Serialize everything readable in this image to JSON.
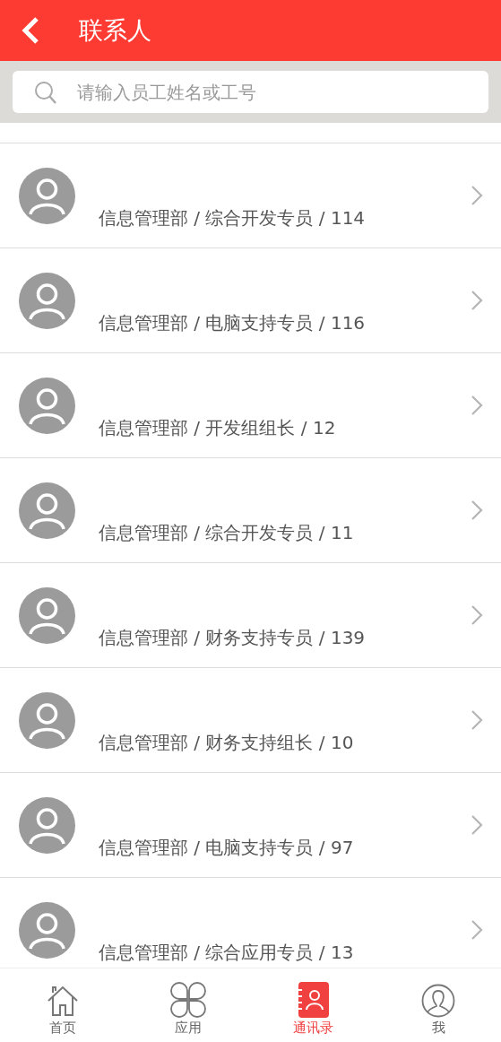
{
  "header": {
    "title": "联系人"
  },
  "search": {
    "placeholder": "请输入员工姓名或工号"
  },
  "contacts": [
    {
      "detail": "信息管理部 / 综合开发专员 / 114"
    },
    {
      "detail": "信息管理部 / 电脑支持专员 / 116"
    },
    {
      "detail": "信息管理部 / 开发组组长 / 12"
    },
    {
      "detail": "信息管理部 / 综合开发专员 / 11"
    },
    {
      "detail": "信息管理部 / 财务支持专员 / 139"
    },
    {
      "detail": "信息管理部 / 财务支持组长 / 10"
    },
    {
      "detail": "信息管理部 / 电脑支持专员 / 97"
    },
    {
      "detail": "信息管理部 / 综合应用专员 / 13"
    }
  ],
  "tab_bar": [
    {
      "kind": "home",
      "label": "首页",
      "selected": false
    },
    {
      "kind": "apps",
      "label": "应用",
      "selected": false
    },
    {
      "kind": "contacts",
      "label": "通讯录",
      "selected": true
    },
    {
      "kind": "me",
      "label": "我",
      "selected": false
    }
  ]
}
